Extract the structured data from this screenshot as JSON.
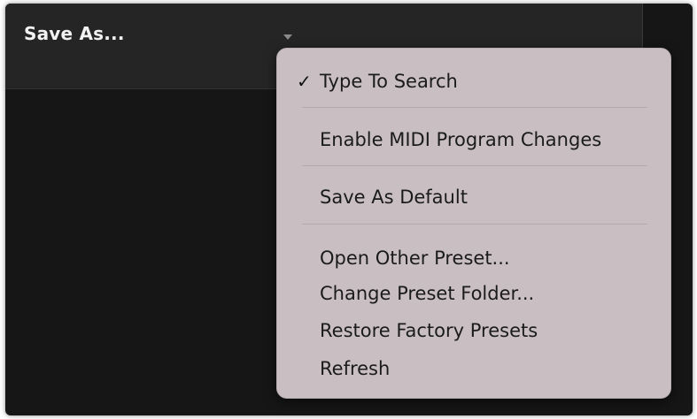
{
  "header": {
    "preset_name": "Save As...",
    "dropdown_icon": "chevron-down-icon"
  },
  "menu": {
    "items": [
      {
        "label": "Type To Search",
        "checked": true,
        "check_glyph": "✓"
      },
      {
        "label": "Enable MIDI Program Changes",
        "checked": false
      },
      {
        "label": "Save As Default",
        "checked": false
      },
      {
        "label": "Open Other Preset...",
        "checked": false
      },
      {
        "label": "Change Preset Folder...",
        "checked": false
      },
      {
        "label": "Restore Factory Presets",
        "checked": false
      },
      {
        "label": "Refresh",
        "checked": false
      }
    ]
  },
  "colors": {
    "window_background": "#161616",
    "header_background": "#252525",
    "menu_background": "#c9bfc2",
    "menu_text": "#1b1b1b",
    "header_text": "#f2f2f2"
  }
}
